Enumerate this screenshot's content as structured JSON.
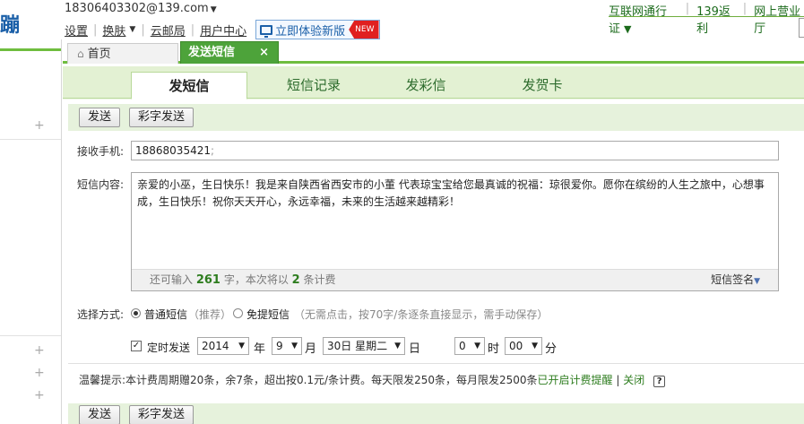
{
  "header": {
    "logo_text": "蹦",
    "account": "18306403302@139.com",
    "links": [
      "设置",
      "换肤",
      "云邮局",
      "用户中心"
    ],
    "new_version_label": "立即体验新版",
    "new_badge": "NEW",
    "right_links": [
      "互联网通行证",
      "139返利",
      "网上营业厅"
    ]
  },
  "tabs": {
    "home": "首页",
    "send_sms": "发送短信"
  },
  "subtabs": [
    "发短信",
    "短信记录",
    "发彩信",
    "发贺卡"
  ],
  "toolbar": {
    "send": "发送",
    "color_send": "彩字发送"
  },
  "form": {
    "recipient_label": "接收手机:",
    "recipient_value": "18868035421",
    "recipient_suffix": ";",
    "content_label": "短信内容:",
    "content_text": "亲爱的小巫，生日快乐！我是来自陕西省西安市的小董 代表琼宝宝给您最真诚的祝福：琼很爱你。愿你在缤纷的人生之旅中，心想事成，生日快乐！祝你天天开心，永远幸福，未来的生活越来越精彩！",
    "counter_prefix": "还可输入",
    "counter_remaining": "261",
    "counter_mid": "字，本次将以",
    "counter_count": "2",
    "counter_suffix": "条计费",
    "signature": "短信签名",
    "method_label": "选择方式:",
    "method_normal": "普通短信",
    "method_normal_note": "（推荐）",
    "method_flash": "免提短信",
    "method_flash_note": "（无需点击，按70字/条逐条直接显示，需手动保存）",
    "scheduled_label": "定时发送",
    "year": "2014",
    "year_unit": "年",
    "month": "9",
    "month_unit": "月",
    "day": "30日 星期二",
    "day_unit": "日",
    "hour": "0",
    "hour_unit": "时",
    "minute": "00",
    "minute_unit": "分"
  },
  "tip": {
    "text": "温馨提示:本计费周期赠20条，余7条，超出按0.1元/条计费。每天限发250条，每月限发2500条",
    "reminder_on": "已开启计费提醒",
    "sep": "|",
    "close": "关闭",
    "help": "?"
  },
  "colors": {
    "accent_green": "#6fbd3f",
    "tab_green": "#4da33a",
    "link_blue": "#1a5fa8",
    "new_red": "#e02020"
  }
}
